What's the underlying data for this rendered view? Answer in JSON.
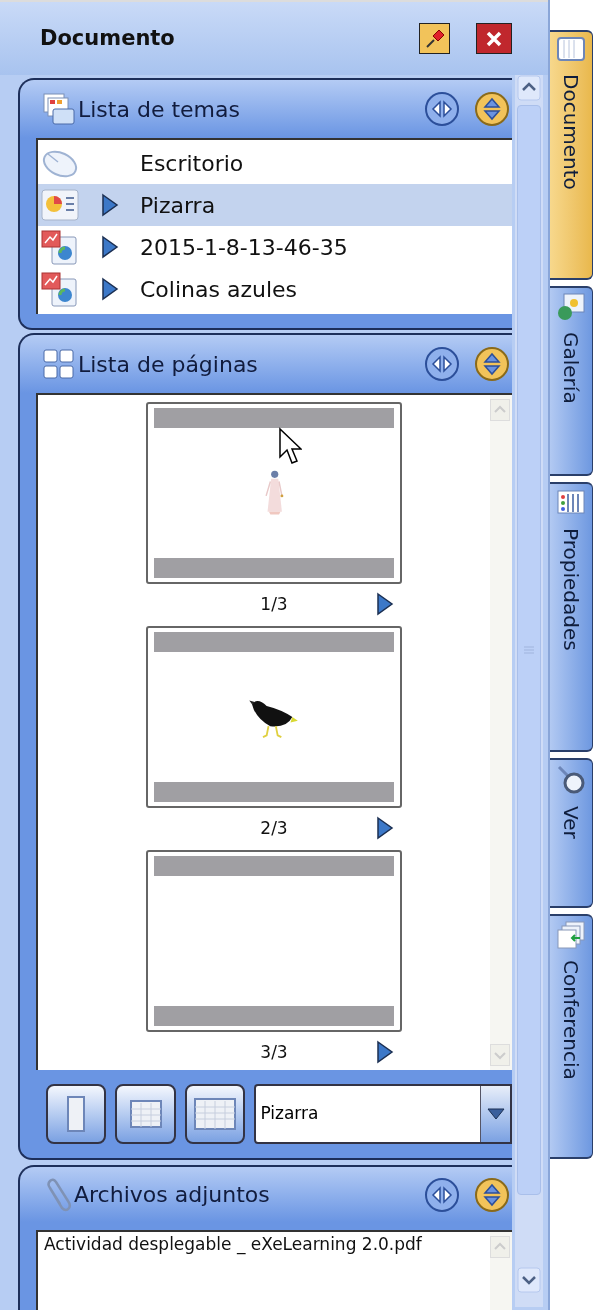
{
  "panel": {
    "title": "Documento"
  },
  "sections": [
    {
      "kind": "topics",
      "title": "Lista de temas",
      "items": [
        {
          "label": "Escritorio",
          "kind": "mouse",
          "expandable": false,
          "selected": false
        },
        {
          "label": "Pizarra",
          "kind": "chart",
          "expandable": true,
          "selected": true
        },
        {
          "label": "2015-1-8-13-46-35",
          "kind": "slide",
          "expandable": true,
          "selected": false
        },
        {
          "label": "Colinas azules",
          "kind": "slide",
          "expandable": true,
          "selected": false
        }
      ]
    },
    {
      "kind": "pages",
      "title": "Lista de páginas",
      "pages": [
        {
          "label": "1/3",
          "kind": "picture"
        },
        {
          "label": "2/3",
          "kind": "picture"
        },
        {
          "label": "3/3"
        }
      ],
      "view_select": {
        "value": "Pizarra"
      }
    },
    {
      "kind": "attachments",
      "title": "Archivos adjuntos",
      "files": [
        "Actividad desplegable _ eXeLearning 2.0.pdf"
      ]
    }
  ],
  "side_tabs": [
    {
      "label": "Documento",
      "selected": true
    },
    {
      "label": "Galería",
      "selected": false
    },
    {
      "label": "Propiedades",
      "selected": false
    },
    {
      "label": "Ver",
      "selected": false
    },
    {
      "label": "Conferencia",
      "selected": false
    }
  ]
}
